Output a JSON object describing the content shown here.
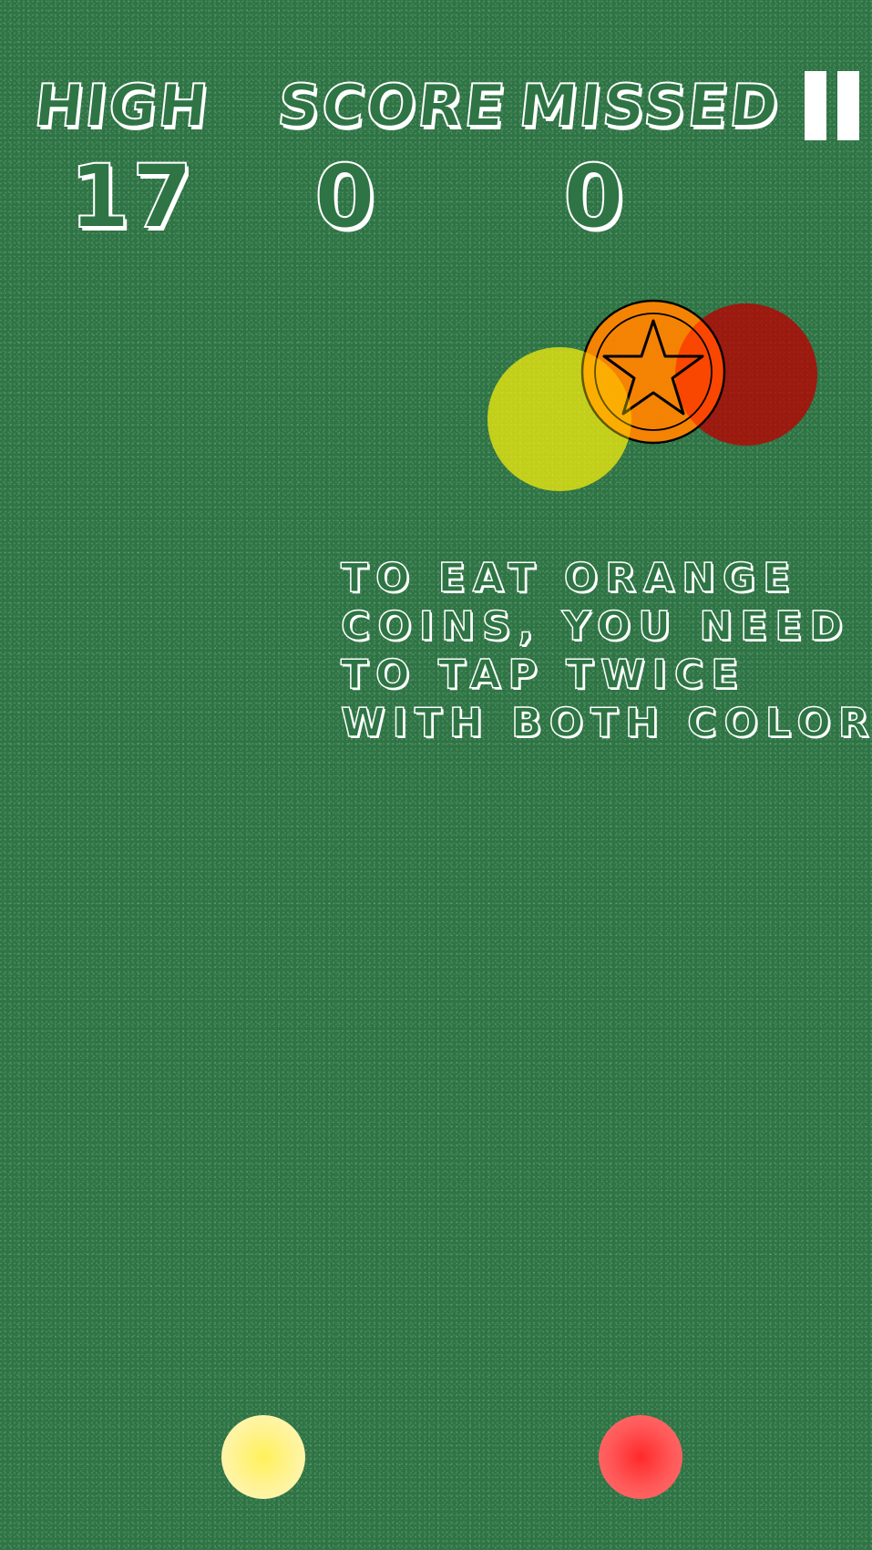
{
  "hud": {
    "high_score_label": "HIGH",
    "high_score_label2": "SCORE",
    "missed_label": "MISSED",
    "high_score_value": "17",
    "score_value": "0",
    "missed_value": "0"
  },
  "hint": {
    "line1": "TO EAT ORANGE",
    "line2": "COINS, YOU NEED",
    "line3": "TO TAP TWICE",
    "line4": "WITH BOTH COLORS"
  },
  "colors": {
    "background": "#2e7444",
    "chalk": "#ffffff",
    "yellow": "#fff27a",
    "red": "#ff4a4a",
    "orange_coin": "#ff8a00"
  },
  "icons": {
    "pause": "pause-icon",
    "coin": "star-coin-icon"
  }
}
